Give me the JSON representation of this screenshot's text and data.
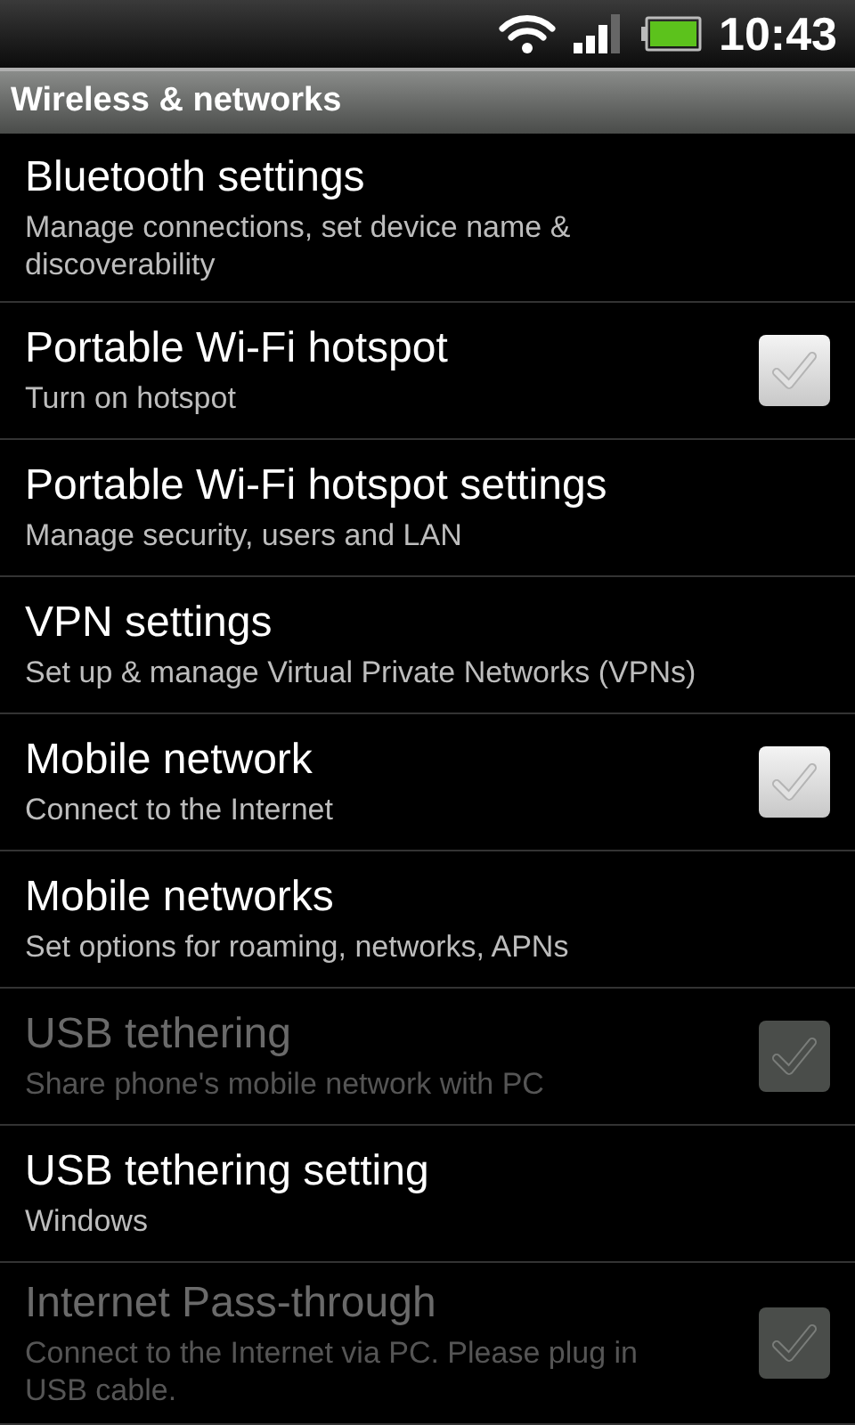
{
  "status_bar": {
    "time": "10:43"
  },
  "header": {
    "title": "Wireless & networks"
  },
  "items": [
    {
      "kind": "link",
      "title": "Bluetooth settings",
      "summary": "Manage connections, set device name & discoverability",
      "disabled": false
    },
    {
      "kind": "checkbox",
      "title": "Portable Wi-Fi hotspot",
      "summary": "Turn on hotspot",
      "checked": false,
      "disabled": false
    },
    {
      "kind": "link",
      "title": "Portable Wi-Fi hotspot settings",
      "summary": "Manage security, users and LAN",
      "disabled": false
    },
    {
      "kind": "link",
      "title": "VPN settings",
      "summary": "Set up & manage Virtual Private Networks (VPNs)",
      "disabled": false
    },
    {
      "kind": "checkbox",
      "title": "Mobile network",
      "summary": "Connect to the Internet",
      "checked": false,
      "disabled": false
    },
    {
      "kind": "link",
      "title": "Mobile networks",
      "summary": "Set options for roaming, networks, APNs",
      "disabled": false
    },
    {
      "kind": "checkbox",
      "title": "USB tethering",
      "summary": "Share phone's mobile network with PC",
      "checked": false,
      "disabled": true
    },
    {
      "kind": "link",
      "title": "USB tethering setting",
      "summary": "Windows",
      "disabled": false
    },
    {
      "kind": "checkbox",
      "title": "Internet Pass-through",
      "summary": "Connect to the Internet via PC. Please plug in USB cable.",
      "checked": false,
      "disabled": true
    }
  ]
}
